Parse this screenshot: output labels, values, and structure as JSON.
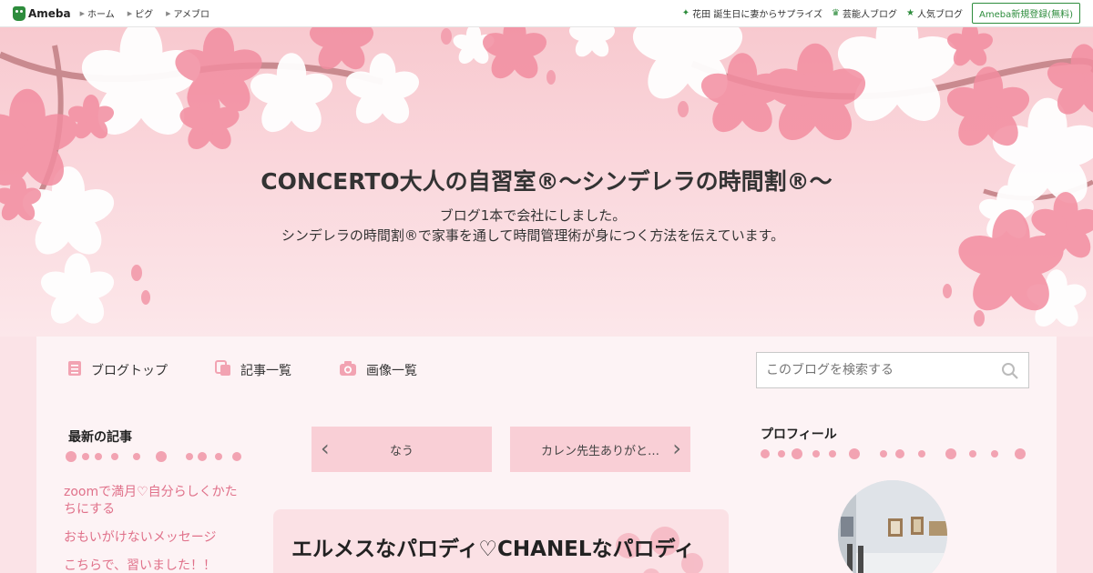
{
  "topbar": {
    "logo": "Ameba",
    "links": [
      "ホーム",
      "ピグ",
      "アメブロ"
    ],
    "right_items": [
      {
        "icon": "sparkle-icon",
        "label": "花田 誕生日に妻からサプライズ"
      },
      {
        "icon": "crown-icon",
        "label": "芸能人ブログ"
      },
      {
        "icon": "star-icon",
        "label": "人気ブログ"
      }
    ],
    "register": "Ameba新規登録(無料)"
  },
  "header": {
    "title": "CONCERTO大人の自習室®～シンデレラの時間割®～",
    "description_line1": "ブログ1本で会社にしました。",
    "description_line2": "シンデレラの時間割®で家事を通して時間管理術が身につく方法を伝えています。"
  },
  "nav": {
    "blog_top": "ブログトップ",
    "entries": "記事一覧",
    "images": "画像一覧"
  },
  "search": {
    "placeholder": "このブログを検索する"
  },
  "sidebar_left": {
    "title": "最新の記事",
    "items": [
      "zoomで満月♡自分らしくかたちにする",
      "おもいがけないメッセージ",
      "こちらで、習いました！！"
    ]
  },
  "pager": {
    "prev": "なう",
    "next": "カレン先生ありがと…"
  },
  "article": {
    "title": "エルメスなパロディ♡CHANELなパロディ"
  },
  "sidebar_right": {
    "title": "プロフィール"
  },
  "colors": {
    "brand_green": "#2d8c3c",
    "link_pink": "#e0718a",
    "pager_bg": "#f9cfd6"
  }
}
